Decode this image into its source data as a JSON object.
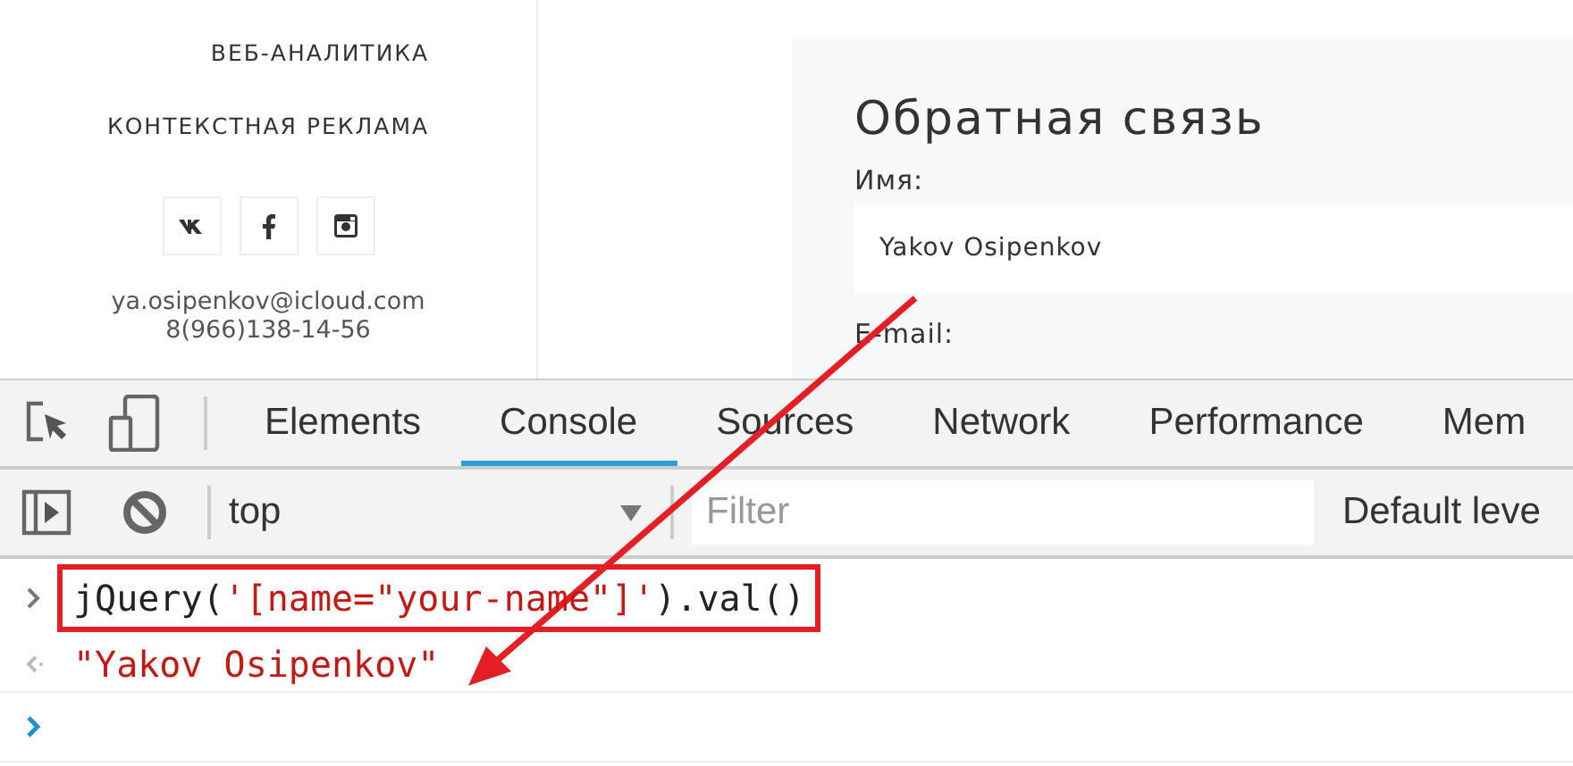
{
  "sidebar": {
    "menu_items": [
      "ВЕБ-АНАЛИТИКА",
      "КОНТЕКСТНАЯ РЕКЛАМА"
    ],
    "social": [
      {
        "kind": "vk"
      },
      {
        "kind": "facebook"
      },
      {
        "kind": "instagram"
      }
    ],
    "email": "ya.osipenkov@icloud.com",
    "phone": "8(966)138-14-56"
  },
  "feedback_form": {
    "title": "Обратная связь",
    "fields": [
      {
        "label": "Имя:",
        "value": "Yakov Osipenkov"
      },
      {
        "label": "E-mail:"
      }
    ]
  },
  "devtools": {
    "tabs": [
      {
        "label": "Elements",
        "selected": false
      },
      {
        "label": "Console",
        "selected": true
      },
      {
        "label": "Sources",
        "selected": false
      },
      {
        "label": "Network",
        "selected": false
      },
      {
        "label": "Performance",
        "selected": false
      },
      {
        "label": "Mem",
        "selected": false
      }
    ],
    "context": "top",
    "filter": {
      "placeholder": "Filter"
    },
    "levels": "Default leve",
    "console": [
      {
        "kind": "input",
        "segments": [
          {
            "kind": "code",
            "text": "jQuery("
          },
          {
            "kind": "string",
            "text": "'[name=\"your-name\"]'"
          },
          {
            "kind": "code",
            "text": ").val()"
          }
        ]
      },
      {
        "kind": "output",
        "segments": [
          {
            "kind": "string",
            "text": "\"Yakov Osipenkov\""
          }
        ]
      },
      {
        "kind": "prompt"
      }
    ]
  }
}
